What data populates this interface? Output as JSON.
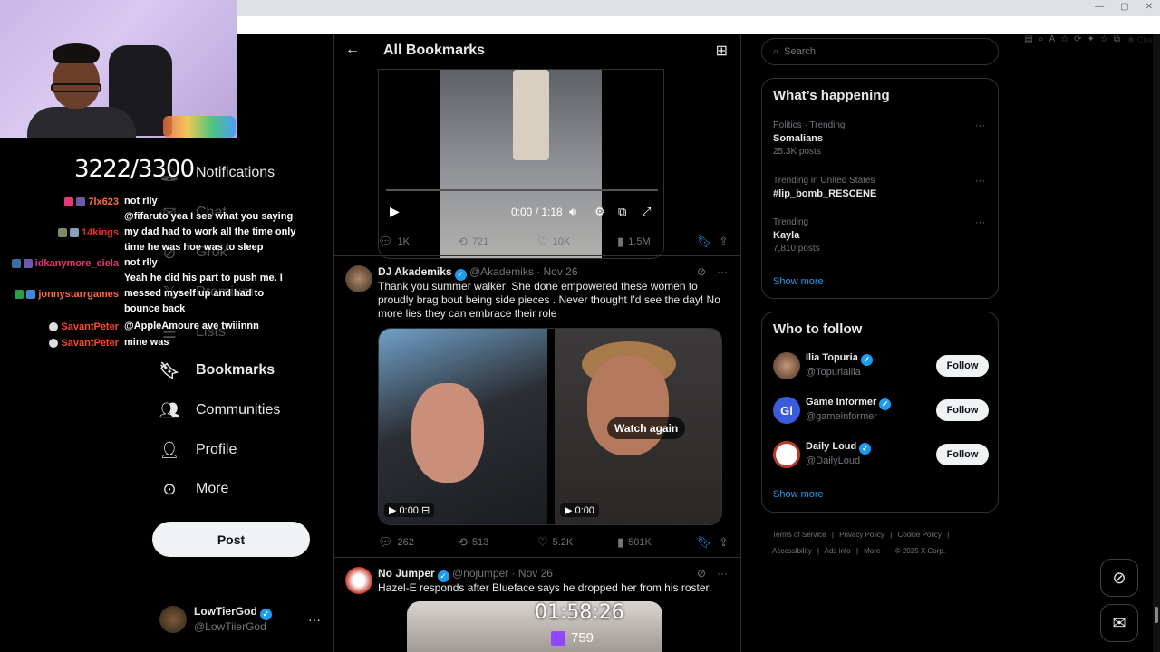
{
  "browser": {
    "chat_label": "Chat"
  },
  "nav": {
    "notifications": "Notifications",
    "chat": "Chat",
    "grok": "Grok",
    "premium": "Premium",
    "lists": "Lists",
    "bookmarks": "Bookmarks",
    "communities": "Communities",
    "profile": "Profile",
    "more": "More",
    "post": "Post"
  },
  "account": {
    "name": "LowTierGod",
    "handle": "@LowTiierGod",
    "more": "···"
  },
  "overlay": {
    "counter": "3222/3300",
    "timer": "01:58:26",
    "viewers": "759"
  },
  "chat": [
    {
      "user": "7lx623",
      "user_color": "#ff6a3d",
      "msg": "not rlly"
    },
    {
      "user": "14kings",
      "user_color": "#e8302a",
      "msg": "@fifaruto yea I see what you saying my dad had to work all the time only time he was hoe was to sleep"
    },
    {
      "user": "idkanymore_ciela",
      "user_color": "#e8367a",
      "msg": "not rlly"
    },
    {
      "user": "jonnystarrgames",
      "user_color": "#ff6a3d",
      "msg": "Yeah he did his part to push me. I messed myself up and had to bounce back"
    },
    {
      "user": "SavantPeter",
      "user_color": "#ff4a2a",
      "msg": "@AppleAmoure ave twiiinnn"
    },
    {
      "user": "SavantPeter",
      "user_color": "#ff4a2a",
      "msg": "mine was"
    }
  ],
  "header": {
    "title": "All Bookmarks"
  },
  "video1": {
    "time": "0:00 / 1:18",
    "stats": {
      "replies": "1K",
      "reposts": "721",
      "likes": "10K",
      "views": "1.5M"
    }
  },
  "tweet2": {
    "name": "DJ Akademiks",
    "handle": "@Akademiks",
    "date": "· Nov 26",
    "text": "Thank you summer walker! She done empowered these women to proudly brag bout being side pieces . Never thought I'd see the day! No more lies they can embrace their role",
    "video_left_time": "0:00",
    "video_right_time": "0:00",
    "watch_again": "Watch again",
    "stats": {
      "replies": "262",
      "reposts": "513",
      "likes": "5.2K",
      "views": "501K"
    }
  },
  "tweet3": {
    "name": "No Jumper",
    "handle": "@nojumper",
    "date": "· Nov 26",
    "text": "Hazel-E responds after Blueface says he dropped her from his roster."
  },
  "search": {
    "placeholder": "Search"
  },
  "trends": {
    "title": "What’s happening",
    "items": [
      {
        "category": "Politics · Trending",
        "name": "Somalians",
        "count": "25.3K posts"
      },
      {
        "category": "Trending in United States",
        "name": "#lip_bomb_RESCENE",
        "count": ""
      },
      {
        "category": "Trending",
        "name": "Kayla",
        "count": "7,810 posts"
      }
    ],
    "show_more": "Show more"
  },
  "who_to_follow": {
    "title": "Who to follow",
    "items": [
      {
        "name": "Ilia Topuria",
        "handle": "@Topuriailia",
        "button": "Follow"
      },
      {
        "name": "Game Informer",
        "handle": "@gameinformer",
        "button": "Follow"
      },
      {
        "name": "Daily Loud",
        "handle": "@DailyLoud",
        "button": "Follow"
      }
    ],
    "show_more": "Show more"
  },
  "footer": {
    "links": [
      "Terms of Service",
      "|",
      "Privacy Policy",
      "|",
      "Cookie Policy",
      "|",
      "Accessibility",
      "|",
      "Ads info",
      "|",
      "More ···",
      "© 2025 X Corp."
    ]
  },
  "colors": {
    "accent": "#1d9bf0",
    "background": "#000000",
    "border": "#2f3336"
  }
}
